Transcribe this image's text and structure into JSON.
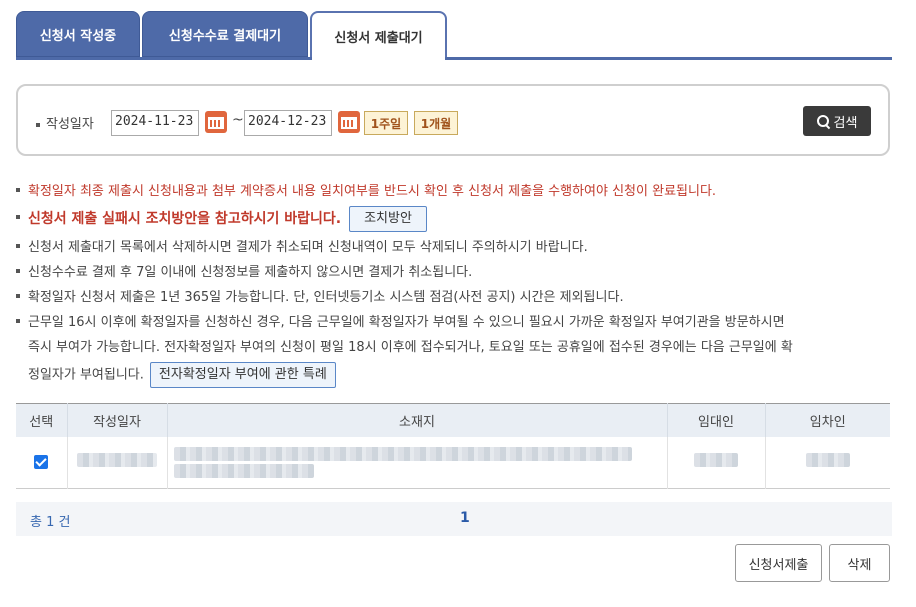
{
  "tabs": [
    {
      "label": "신청서 작성중",
      "active": false
    },
    {
      "label": "신청수수료 결제대기",
      "active": false
    },
    {
      "label": "신청서 제출대기",
      "active": true
    }
  ],
  "search": {
    "label": "작성일자",
    "date_from": "2024-11-23",
    "date_to": "2024-12-23",
    "tilde": "~",
    "period_1week": "1주일",
    "period_1month": "1개월",
    "search_button": "검색"
  },
  "notices": {
    "n1": "확정일자 최종 제출시 신청내용과 첨부 계약증서 내용 일치여부를 반드시 확인 후 신청서 제출을 수행하여야 신청이 완료됩니다.",
    "n2": "신청서 제출 실패시 조치방안을 참고하시기 바랍니다.",
    "n2_button": "조치방안",
    "n3": "신청서 제출대기 목록에서 삭제하시면 결제가 취소되며 신청내역이 모두 삭제되니 주의하시기 바랍니다.",
    "n4": "신청수수료 결제 후 7일 이내에 신청정보를 제출하지 않으시면 결제가 취소됩니다.",
    "n5": "확정일자 신청서 제출은 1년 365일 가능합니다. 단, 인터넷등기소 시스템 점검(사전 공지) 시간은 제외됩니다.",
    "n6_line1": "근무일 16시 이후에 확정일자를 신청하신 경우, 다음 근무일에 확정일자가 부여될 수 있으니 필요시 가까운 확정일자 부여기관을 방문하시면",
    "n6_line2": "즉시 부여가 가능합니다. 전자확정일자 부여의 신청이 평일 18시 이후에 접수되거나, 토요일 또는 공휴일에 접수된 경우에는 다음 근무일에 확",
    "n6_line3": "정일자가 부여됩니다.",
    "n6_button": "전자확정일자 부여에 관한 특례"
  },
  "table": {
    "headers": [
      "선택",
      "작성일자",
      "소재지",
      "임대인",
      "임차인"
    ],
    "rows": [
      {
        "selected": true
      }
    ]
  },
  "footer": {
    "total": "총 1 건",
    "page": "1",
    "submit_button": "신청서제출",
    "delete_button": "삭제"
  }
}
